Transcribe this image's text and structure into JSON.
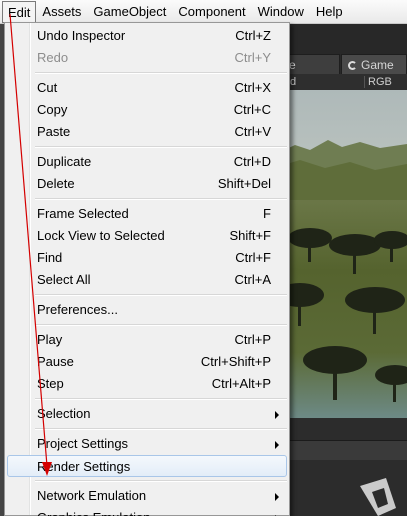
{
  "menubar": {
    "items": [
      "Edit",
      "Assets",
      "GameObject",
      "Component",
      "Window",
      "Help"
    ]
  },
  "editor": {
    "tab_partial": "e",
    "game_tab": "Game",
    "left_toolbar_fragment": "d",
    "rgb_label": "RGB"
  },
  "edit_menu": {
    "items": [
      {
        "label": "Undo Inspector",
        "shortcut": "Ctrl+Z"
      },
      {
        "label": "Redo",
        "shortcut": "Ctrl+Y"
      },
      {
        "label": "Cut",
        "shortcut": "Ctrl+X"
      },
      {
        "label": "Copy",
        "shortcut": "Ctrl+C"
      },
      {
        "label": "Paste",
        "shortcut": "Ctrl+V"
      },
      {
        "label": "Duplicate",
        "shortcut": "Ctrl+D"
      },
      {
        "label": "Delete",
        "shortcut": "Shift+Del"
      },
      {
        "label": "Frame Selected",
        "shortcut": "F"
      },
      {
        "label": "Lock View to Selected",
        "shortcut": "Shift+F"
      },
      {
        "label": "Find",
        "shortcut": "Ctrl+F"
      },
      {
        "label": "Select All",
        "shortcut": "Ctrl+A"
      },
      {
        "label": "Preferences...",
        "shortcut": ""
      },
      {
        "label": "Play",
        "shortcut": "Ctrl+P"
      },
      {
        "label": "Pause",
        "shortcut": "Ctrl+Shift+P"
      },
      {
        "label": "Step",
        "shortcut": "Ctrl+Alt+P"
      },
      {
        "label": "Selection",
        "shortcut": ""
      },
      {
        "label": "Project Settings",
        "shortcut": ""
      },
      {
        "label": "Render Settings",
        "shortcut": ""
      },
      {
        "label": "Network Emulation",
        "shortcut": ""
      },
      {
        "label": "Graphics Emulation",
        "shortcut": ""
      }
    ]
  },
  "annotation_color": "#d40000"
}
